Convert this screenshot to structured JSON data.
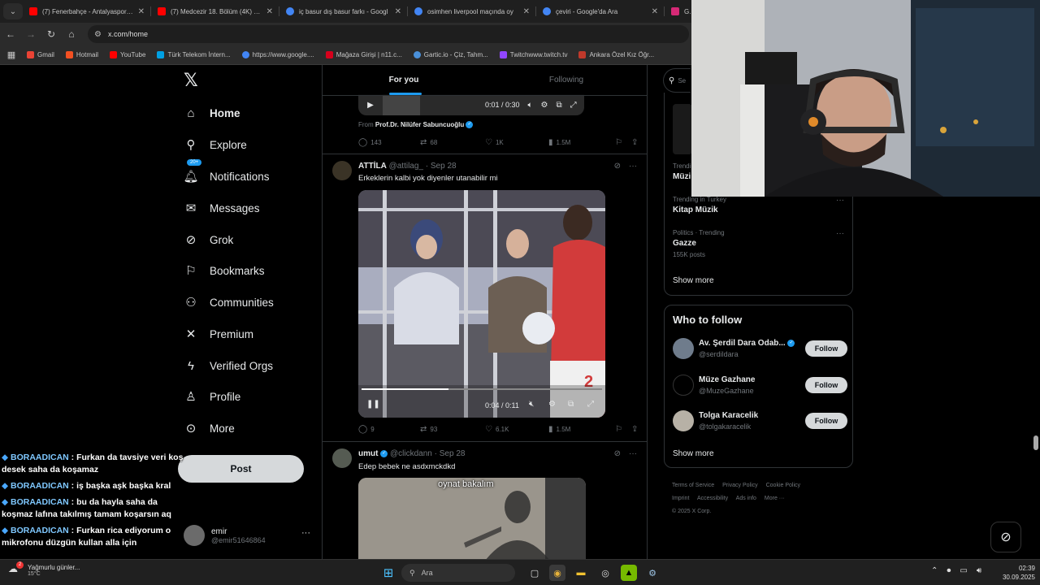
{
  "browser": {
    "tabs": [
      {
        "label": "(7) Fenerbahçe - Antalyaspor - Y",
        "color": "#ff0000"
      },
      {
        "label": "(7) Medcezir 18. Bölüm (4K) - Y",
        "color": "#ff0000"
      },
      {
        "label": "iç basur dış basur farkı - Googl",
        "color": "#4285f4"
      },
      {
        "label": "osimhen liverpool maçında oy",
        "color": "#4285f4"
      },
      {
        "label": "çeviri - Google'da Ara",
        "color": "#4285f4"
      },
      {
        "label": "Ge",
        "color": "#d62976"
      }
    ],
    "url": "x.com/home",
    "bookmarks": [
      {
        "label": "Gmail",
        "color": "#ea4335"
      },
      {
        "label": "Hotmail",
        "color": "#f25022"
      },
      {
        "label": "YouTube",
        "color": "#ff0000"
      },
      {
        "label": "Türk Telekom İntern...",
        "color": "#00a0e3"
      },
      {
        "label": "https://www.google....",
        "color": "#4285f4"
      },
      {
        "label": "Mağaza Girişi | n11.c...",
        "color": "#d6001c"
      },
      {
        "label": "Gartic.io - Çiz, Tahm...",
        "color": "#4a90d9"
      },
      {
        "label": "Twitchwww.twitch.tv",
        "color": "#9146ff"
      },
      {
        "label": "Ankara Özel Kız Öğr...",
        "color": "#c0392b"
      }
    ]
  },
  "nav": {
    "items": [
      {
        "label": "Home",
        "icon": "home-icon",
        "glyph": "⌂"
      },
      {
        "label": "Explore",
        "icon": "search-icon",
        "glyph": "⚲"
      },
      {
        "label": "Notifications",
        "icon": "bell-icon",
        "glyph": "♫"
      },
      {
        "label": "Messages",
        "icon": "mail-icon",
        "glyph": "✉"
      },
      {
        "label": "Grok",
        "icon": "grok-icon",
        "glyph": "⊘"
      },
      {
        "label": "Bookmarks",
        "icon": "bookmark-icon",
        "glyph": "❐"
      },
      {
        "label": "Communities",
        "icon": "communities-icon",
        "glyph": "⚇"
      },
      {
        "label": "Premium",
        "icon": "x-premium-icon",
        "glyph": "✕"
      },
      {
        "label": "Verified Orgs",
        "icon": "lightning-icon",
        "glyph": "ϟ"
      },
      {
        "label": "Profile",
        "icon": "person-icon",
        "glyph": "♙"
      },
      {
        "label": "More",
        "icon": "more-circle-icon",
        "glyph": "⊙"
      }
    ],
    "notifications_badge": "20+",
    "post_label": "Post",
    "account": {
      "name": "emir",
      "handle": "@emir51646864"
    }
  },
  "chat": [
    {
      "user": "BORAADICAN",
      "message": "Furkan da tavsiye veri koş desek saha da koşamaz"
    },
    {
      "user": "BORAADICAN",
      "message": "iş başka aşk başka kral"
    },
    {
      "user": "BORAADICAN",
      "message": "bu da hayla saha da koşmaz lafına takılmış tamam koşarsın aq"
    },
    {
      "user": "BORAADICAN",
      "message": "Furkan rica ediyorum o mikrofonu düzgün kullan alla için"
    }
  ],
  "timeline": {
    "tabs": [
      "For you",
      "Following"
    ],
    "tweet1": {
      "player_time": "0:01 / 0:30",
      "from_prefix": "From",
      "from_name": "Prof.Dr. Nilüfer Sabuncuoğlu",
      "replies": "143",
      "reposts": "68",
      "likes": "1K",
      "views": "1.5M"
    },
    "tweet2": {
      "name": "ATTİLA",
      "meta": "@attilag_ · Sep 28",
      "text": "Erkeklerin kalbi yok diyenler utanabilir mi",
      "player_time": "0:04 / 0:11",
      "video_progress": 0.36,
      "replies": "9",
      "reposts": "93",
      "likes": "6.1K",
      "views": "1.5M"
    },
    "tweet3": {
      "name": "umut",
      "meta": "@clickdann · Sep 28",
      "text": "Edep bebek ne asdxmckdkd",
      "video_caption": "oynat bakalım"
    }
  },
  "right": {
    "search_placeholder": "Se",
    "trends": [
      {
        "category": "Trending",
        "name": "Müzi",
        "count": ""
      },
      {
        "category": "Trending in Turkey",
        "name": "Kitap Müzik",
        "count": ""
      },
      {
        "category": "Politics · Trending",
        "name": "Gazze",
        "count": "155K posts"
      }
    ],
    "show_more": "Show more",
    "who_to_follow": {
      "title": "Who to follow",
      "items": [
        {
          "name": "Av. Şerdil Dara Odab...",
          "handle": "@serdildara",
          "verified": true,
          "follow": "Follow"
        },
        {
          "name": "Müze Gazhane",
          "handle": "@MuzeGazhane",
          "verified": false,
          "follow": "Follow"
        },
        {
          "name": "Tolga Karacelik",
          "handle": "@tolgakaracelik",
          "verified": false,
          "follow": "Follow"
        }
      ],
      "show_more": "Show more"
    },
    "footer": [
      "Terms of Service",
      "Privacy Policy",
      "Cookie Policy",
      "Imprint",
      "Accessibility",
      "Ads info",
      "More ···",
      "© 2025 X Corp."
    ]
  },
  "taskbar": {
    "weather_text": "Yağmurlu günler...",
    "weather_temp": "15°C",
    "weather_badge": "2",
    "search_label": "Ara",
    "time": "02:39",
    "date": "30.09.2025"
  }
}
